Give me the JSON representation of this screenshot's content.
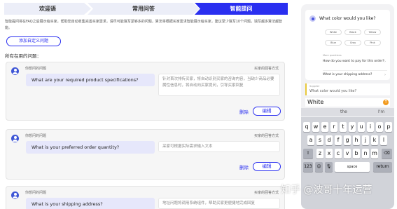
{
  "steps": [
    "欢迎语",
    "常用问答",
    "智能提问"
  ],
  "description": "智能提问将在FAQ之后展示给买家，帮助您自动收集完善买家需求，请尽可能填写足够多的问题，算法将根据买家需求智能展示给买家，建议至少填写10个问题，填写越多算法越智能。",
  "add_button": "添加自定义问题",
  "all_questions_label": "所有在用的问题：",
  "question_label": "你想问的问题",
  "answer_label": "买家的回答方式",
  "delete_label": "删除",
  "edit_label": "编辑",
  "questions": [
    {
      "q": "What are your required product specifications?",
      "a": "针对首次排传买家，将自动识别买家的咨询内容，当缺少商品必要属性信息时，将自动向买家提问，引导买家回复"
    },
    {
      "q": "What is your preferred order quantity?",
      "a": "采家可根据实际需求输入文本"
    },
    {
      "q": "What is your shipping address?",
      "a": "地址问题将调用系统组件，帮助买家更便捷地完成回复"
    }
  ],
  "preview": {
    "bot_question": "What color would you like?",
    "options": [
      "White",
      "Black",
      "Yellow",
      "Blue",
      "Gray",
      "Pink"
    ],
    "more_label": "More questions",
    "more_questions": [
      "How do you want to pay for this order?",
      "What is your shipping address?"
    ],
    "supplier_label": "Supplier",
    "supplier_text": "What color would you like?",
    "input_value": "White",
    "suggestions": [
      "the",
      "I'm"
    ],
    "keyboard_rows": [
      [
        "q",
        "w",
        "e",
        "r",
        "t",
        "y",
        "u",
        "i",
        "o",
        "p"
      ],
      [
        "a",
        "s",
        "d",
        "f",
        "g",
        "h",
        "j",
        "k",
        "l"
      ],
      [
        "⇧",
        "z",
        "x",
        "c",
        "v",
        "b",
        "n",
        "m",
        "⌫"
      ]
    ],
    "bottom_keys": [
      "123",
      "☺",
      "🎙",
      "space",
      "return"
    ],
    "send_icon": "arrow-up-icon"
  },
  "watermark": "知乎 @波哥十年运营"
}
